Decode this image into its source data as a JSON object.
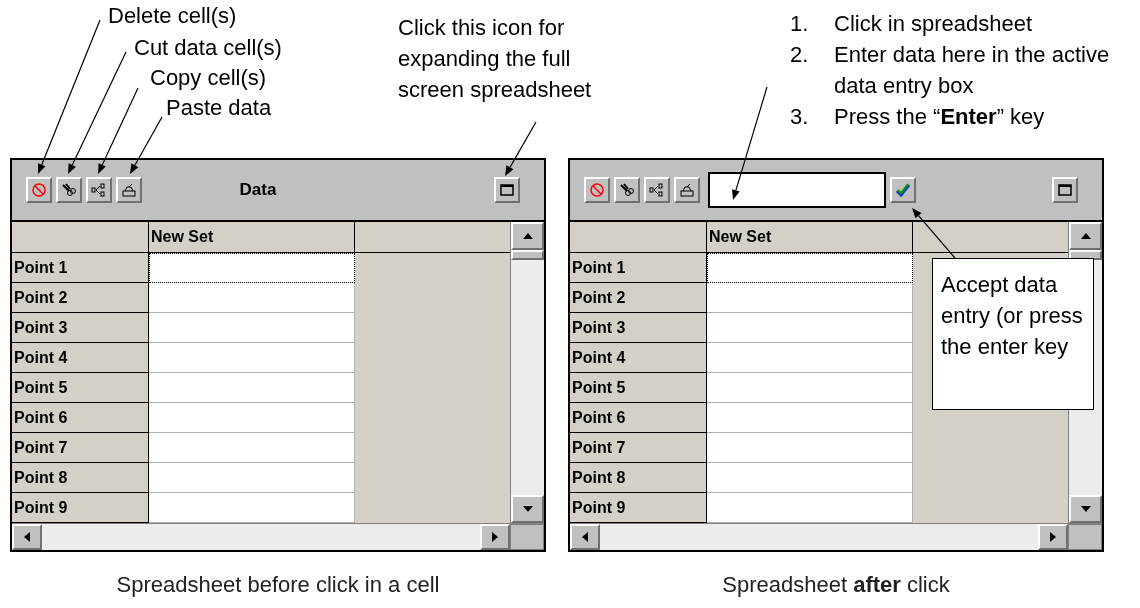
{
  "annotations": [
    {
      "text": "Delete cell(s)"
    },
    {
      "text": "Cut data cell(s)"
    },
    {
      "text": "Copy cell(s)"
    },
    {
      "text": "Paste data"
    },
    {
      "text": "Click this icon for expanding the full screen spreadsheet"
    }
  ],
  "steps": [
    {
      "number": "1.",
      "text": "Click in spreadsheet"
    },
    {
      "number": "2.",
      "text": "Enter data here in the active data entry box"
    },
    {
      "number": "3.",
      "text": "Press the “**Enter**” key"
    }
  ],
  "callout": "Accept data entry (or press the enter key",
  "panels": [
    {
      "title": "Data",
      "entry_box": false,
      "column_header": "New Set",
      "caption": "Spreadsheet before click in a cell",
      "rows": [
        {
          "label": "Point 1",
          "selected": true
        },
        {
          "label": "Point 2",
          "selected": false
        },
        {
          "label": "Point 3",
          "selected": false
        },
        {
          "label": "Point 4",
          "selected": false
        },
        {
          "label": "Point 5",
          "selected": false
        },
        {
          "label": "Point 6",
          "selected": false
        },
        {
          "label": "Point 7",
          "selected": false
        },
        {
          "label": "Point 8",
          "selected": false
        },
        {
          "label": "Point 9",
          "selected": false
        }
      ]
    },
    {
      "entry_box": true,
      "column_header": "New Set",
      "caption": "Spreadsheet **after** click",
      "rows": [
        {
          "label": "Point 1",
          "selected": true
        },
        {
          "label": "Point 2",
          "selected": false
        },
        {
          "label": "Point 3",
          "selected": false
        },
        {
          "label": "Point 4",
          "selected": false
        },
        {
          "label": "Point 5",
          "selected": false
        },
        {
          "label": "Point 6",
          "selected": false
        },
        {
          "label": "Point 7",
          "selected": false
        },
        {
          "label": "Point 8",
          "selected": false
        },
        {
          "label": "Point 9",
          "selected": false
        }
      ]
    }
  ]
}
